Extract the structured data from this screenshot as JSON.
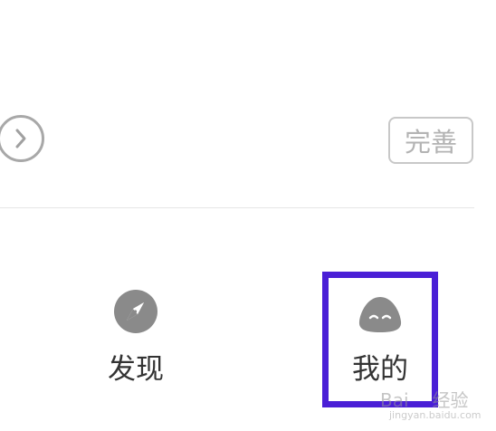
{
  "header": {
    "complete_label": "完善"
  },
  "bottom_nav": {
    "discover_label": "发现",
    "mine_label": "我的"
  },
  "watermark": {
    "brand": "Bai",
    "suffix": "经验",
    "url": "jingyan.baidu.com"
  },
  "colors": {
    "highlight": "#4a1fd6",
    "icon_gray": "#8a8a8a",
    "text": "#333333"
  },
  "icons": {
    "chevron": "chevron-right-icon",
    "discover": "compass-icon",
    "mine": "smiling-blob-icon"
  }
}
